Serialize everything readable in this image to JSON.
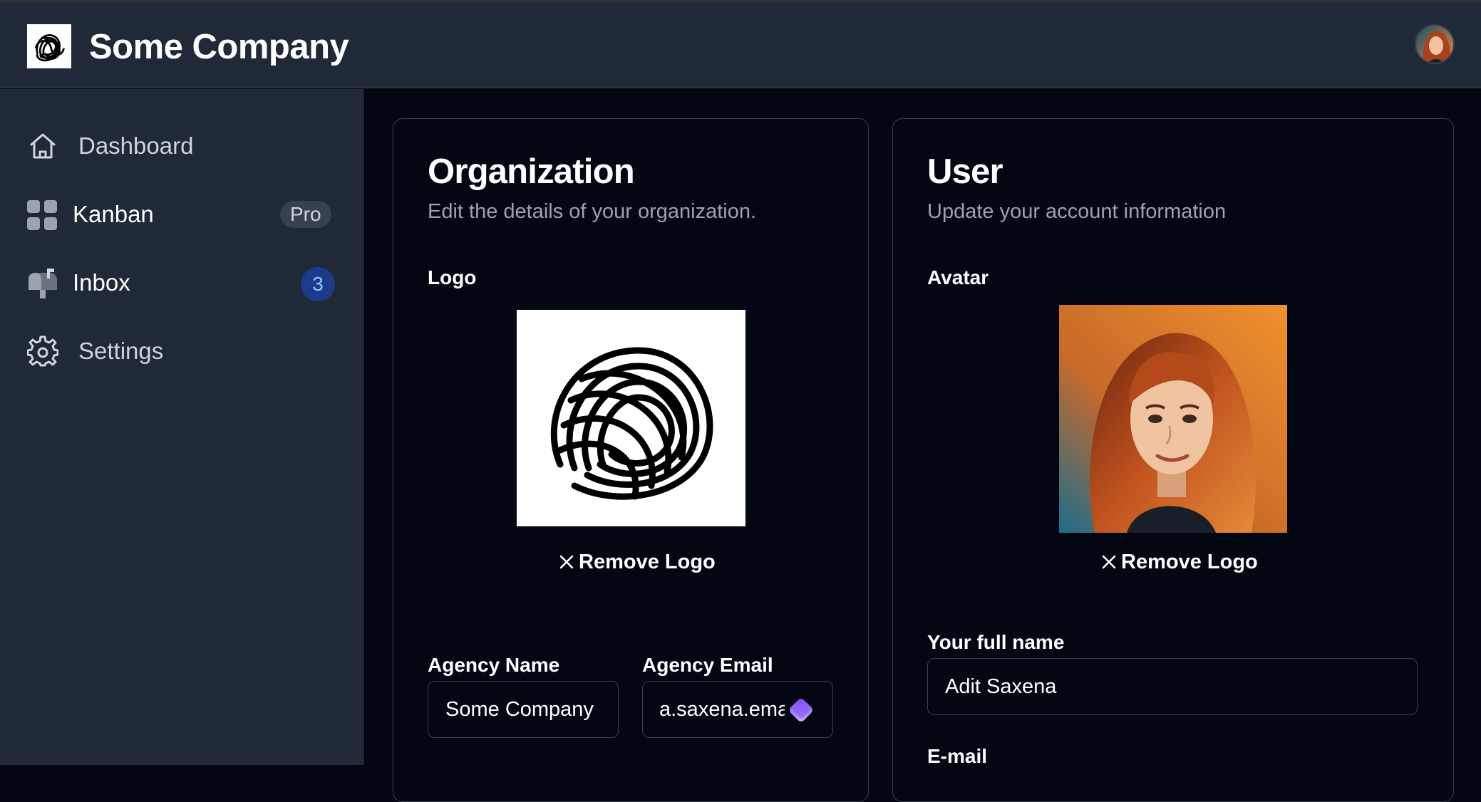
{
  "app": {
    "company_name": "Some Company"
  },
  "sidebar": {
    "items": [
      {
        "label": "Dashboard",
        "icon": "home-icon"
      },
      {
        "label": "Kanban",
        "icon": "grid-icon",
        "badge": "Pro"
      },
      {
        "label": "Inbox",
        "icon": "mailbox-icon",
        "count": "3"
      },
      {
        "label": "Settings",
        "icon": "gear-icon"
      }
    ]
  },
  "organization": {
    "title": "Organization",
    "subtitle": "Edit the details of your organization.",
    "logo_label": "Logo",
    "remove_label": "Remove Logo",
    "agency_name_label": "Agency Name",
    "agency_name_value": "Some Company",
    "agency_email_label": "Agency Email",
    "agency_email_value": "a.saxena.email@gmail.com"
  },
  "user": {
    "title": "User",
    "subtitle": "Update your account information",
    "avatar_label": "Avatar",
    "remove_label": "Remove Logo",
    "full_name_label": "Your full name",
    "full_name_value": "Adit Saxena",
    "email_label": "E-mail"
  },
  "colors": {
    "background": "#030712",
    "panel": "#1f2937",
    "border": "#374151",
    "muted_text": "#9ca3af",
    "badge_blue": "#1e3a8a"
  }
}
